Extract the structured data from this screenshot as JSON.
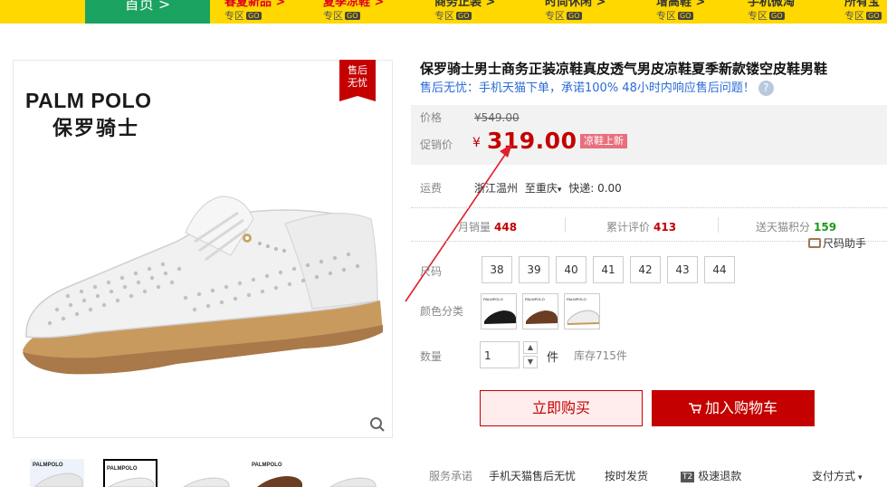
{
  "nav": {
    "home_label": "首页 >",
    "categories": [
      {
        "title": "春夏新品 >",
        "sub": "专区",
        "go": "GO"
      },
      {
        "title": "夏季凉鞋 >",
        "sub": "专区",
        "go": "GO"
      },
      {
        "title": "商务正装 >",
        "sub": "专区",
        "go": "GO"
      },
      {
        "title": "时尚休闲 >",
        "sub": "专区",
        "go": "GO"
      },
      {
        "title": "增高鞋 >",
        "sub": "专区",
        "go": "GO"
      },
      {
        "title": "手机微淘",
        "sub": "专区",
        "go": "GO"
      },
      {
        "title": "所有宝",
        "sub": "专区",
        "go": "GO"
      }
    ]
  },
  "gallery": {
    "badge_line1": "售后",
    "badge_line2": "无忧",
    "brand_en": "PALM POLO",
    "brand_cn": "保罗骑士",
    "thumb_brand": "PALMPOLO"
  },
  "product": {
    "title": "保罗骑士男士商务正装凉鞋真皮透气男皮凉鞋夏季新款镂空皮鞋男鞋",
    "subtitle": "售后无忧：手机天猫下单，承诺100% 48小时内响应售后问题！",
    "help_mark": "?"
  },
  "price": {
    "orig_label": "价格",
    "orig_price": "¥549.00",
    "promo_label": "促销价",
    "currency": "¥",
    "promo_price": "319.00",
    "promo_tag": "凉鞋上新"
  },
  "shipping": {
    "label": "运费",
    "from": "浙江温州",
    "to": "至重庆",
    "method": "快递: 0.00"
  },
  "stats": {
    "monthly_sales_label": "月销量",
    "monthly_sales": "448",
    "reviews_label": "累计评价",
    "reviews": "413",
    "points_label": "送天猫积分",
    "points": "159",
    "size_helper": "尺码助手"
  },
  "options": {
    "size_label": "尺码",
    "sizes": [
      "38",
      "39",
      "40",
      "41",
      "42",
      "43",
      "44"
    ],
    "color_label": "颜色分类"
  },
  "quantity": {
    "label": "数量",
    "value": "1",
    "unit": "件",
    "stock": "库存715件"
  },
  "actions": {
    "buy_now": "立即购买",
    "add_cart": "加入购物车"
  },
  "promise": {
    "label": "服务承诺",
    "items": [
      "手机天猫售后无忧",
      "按时发货",
      "极速退款"
    ],
    "t2": "T2",
    "payment": "支付方式"
  },
  "colors": {
    "accent": "#c40000",
    "nav_bg": "#ffd800",
    "home_bg": "#1aa260",
    "link": "#2b6bd6"
  }
}
